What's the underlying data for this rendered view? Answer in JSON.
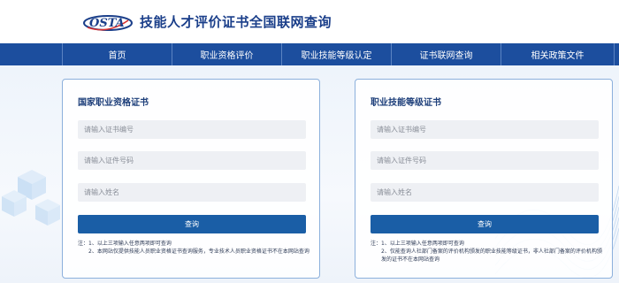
{
  "header": {
    "logo_text": "OSTA",
    "site_title": "技能人才评价证书全国联网查询"
  },
  "nav": {
    "items": [
      "首页",
      "职业资格评价",
      "职业技能等级认定",
      "证书联网查询",
      "相关政策文件"
    ]
  },
  "cards": [
    {
      "title": "国家职业资格证书",
      "placeholders": [
        "请输入证书编号",
        "请输入证件号码",
        "请输入姓名"
      ],
      "button": "查询",
      "notes": [
        "注：1、以上三项输入任意两项即可查询",
        "2、本网站仅提供技能人员职业资格证书查询服务，专业技术人员职业资格证书不在本网站查询"
      ]
    },
    {
      "title": "职业技能等级证书",
      "placeholders": [
        "请输入证书编号",
        "请输入证件号码",
        "请输入姓名"
      ],
      "button": "查询",
      "notes": [
        "注：1、以上三项输入任意两项即可查询",
        "2、仅能查询人社部门备案的评价机构颁发的职业技能等级证书，非人社部门备案的评价机构颁发的证书不在本网站查询"
      ]
    }
  ],
  "colors": {
    "nav_bg": "#1c4e9e",
    "title_blue": "#1b3f8a",
    "button_blue": "#1a5ea6",
    "card_border": "#8cb0dc"
  }
}
